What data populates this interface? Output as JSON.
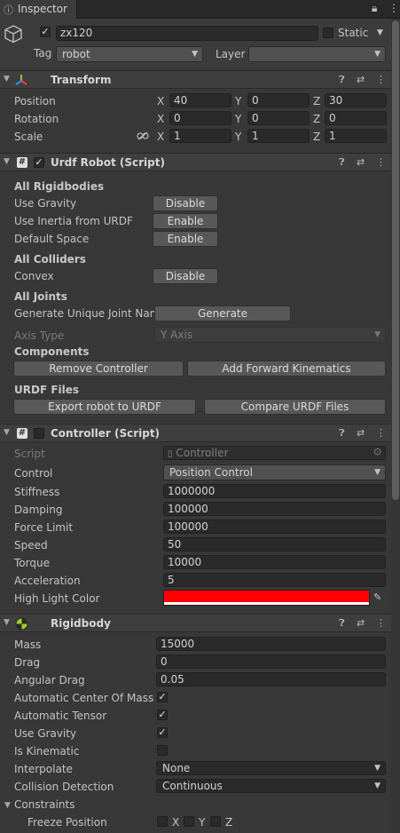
{
  "tab": {
    "label": "Inspector"
  },
  "object": {
    "name": "zx120",
    "static_label": "Static",
    "tag_label": "Tag",
    "tag_value": "robot",
    "layer_label": "Layer",
    "layer_value": ""
  },
  "transform": {
    "title": "Transform",
    "position": {
      "label": "Position",
      "x": "40",
      "y": "0",
      "z": "30"
    },
    "rotation": {
      "label": "Rotation",
      "x": "0",
      "y": "0",
      "z": "0"
    },
    "scale": {
      "label": "Scale",
      "x": "1",
      "y": "1",
      "z": "1"
    },
    "axes": {
      "x": "X",
      "y": "Y",
      "z": "Z"
    }
  },
  "urdf": {
    "title": "Urdf Robot (Script)",
    "all_rigidbodies": "All Rigidbodies",
    "use_gravity": {
      "label": "Use Gravity",
      "button": "Disable"
    },
    "use_inertia": {
      "label": "Use Inertia from URDF",
      "button": "Enable"
    },
    "default_space": {
      "label": "Default Space",
      "button": "Enable"
    },
    "all_colliders": "All Colliders",
    "convex": {
      "label": "Convex",
      "button": "Disable"
    },
    "all_joints": "All Joints",
    "unique_joint": {
      "label": "Generate Unique Joint Nam",
      "button": "Generate"
    },
    "axis_type": {
      "label": "Axis Type",
      "value": "Y Axis"
    },
    "components": "Components",
    "remove_controller": "Remove Controller",
    "add_fk": "Add Forward Kinematics",
    "urdf_files": "URDF Files",
    "export": "Export robot to URDF",
    "compare": "Compare URDF Files"
  },
  "controller": {
    "title": "Controller (Script)",
    "script": {
      "label": "Script",
      "value": "Controller"
    },
    "control": {
      "label": "Control",
      "value": "Position Control"
    },
    "stiffness": {
      "label": "Stiffness",
      "value": "1000000"
    },
    "damping": {
      "label": "Damping",
      "value": "100000"
    },
    "force_limit": {
      "label": "Force Limit",
      "value": "100000"
    },
    "speed": {
      "label": "Speed",
      "value": "50"
    },
    "torque": {
      "label": "Torque",
      "value": "10000"
    },
    "acceleration": {
      "label": "Acceleration",
      "value": "5"
    },
    "high_light_color": {
      "label": "High Light Color",
      "color": "#ff0000"
    }
  },
  "rigidbody": {
    "title": "Rigidbody",
    "mass": {
      "label": "Mass",
      "value": "15000"
    },
    "drag": {
      "label": "Drag",
      "value": "0"
    },
    "angular_drag": {
      "label": "Angular Drag",
      "value": "0.05"
    },
    "auto_com": {
      "label": "Automatic Center Of Mass",
      "checked": true
    },
    "auto_tensor": {
      "label": "Automatic Tensor",
      "checked": true
    },
    "use_gravity": {
      "label": "Use Gravity",
      "checked": true
    },
    "is_kinematic": {
      "label": "Is Kinematic",
      "checked": false
    },
    "interpolate": {
      "label": "Interpolate",
      "value": "None"
    },
    "collision": {
      "label": "Collision Detection",
      "value": "Continuous"
    },
    "constraints": "Constraints",
    "freeze_position": {
      "label": "Freeze Position",
      "x": "X",
      "y": "Y",
      "z": "Z"
    }
  },
  "colors": {
    "background": "#383838",
    "header": "#3e3e3e",
    "field": "#2a2a2a",
    "button": "#585858",
    "highlight": "#ff0000"
  }
}
